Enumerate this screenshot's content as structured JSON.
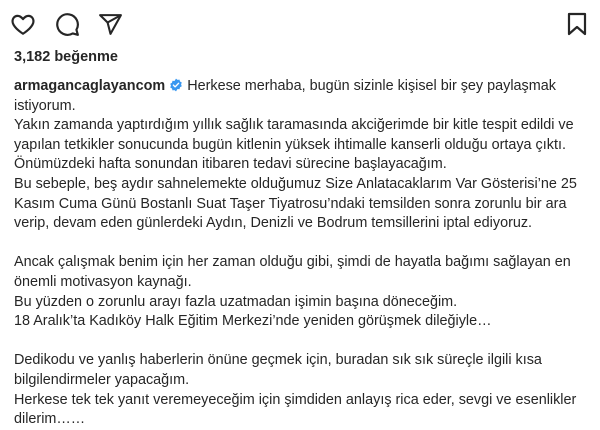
{
  "post": {
    "likes_text": "3,182 beğenme",
    "username": "armagancaglayancom",
    "verified": true,
    "caption_first_line": "Herkese merhaba, bugün sizinle kişisel bir şey paylaşmak",
    "caption_lines": [
      "istiyorum.",
      "Yakın zamanda yaptırdığım yıllık sağlık taramasında akciğerimde bir kitle tespit edildi ve",
      "yapılan tetkikler sonucunda bugün kitlenin yüksek ihtimalle kanserli olduğu ortaya çıktı.",
      "Önümüzdeki hafta sonundan itibaren tedavi sürecine başlayacağım.",
      "Bu sebeple, beş aydır sahnelemekte olduğumuz Size Anlatacaklarım Var Gösterisi’ne 25",
      "Kasım Cuma Günü Bostanlı Suat Taşer Tiyatrosu’ndaki temsilden sonra zorunlu bir ara",
      "verip, devam eden günlerdeki Aydın, Denizli ve Bodrum temsillerini iptal ediyoruz.",
      "",
      "Ancak çalışmak benim için her zaman olduğu gibi, şimdi de hayatla bağımı sağlayan en",
      "önemli motivasyon kaynağı.",
      "Bu yüzden o zorunlu arayı fazla uzatmadan işimin başına döneceğim.",
      "18 Aralık’ta Kadıköy Halk Eğitim Merkezi’nde yeniden görüşmek dileğiyle…",
      "",
      "Dedikodu ve yanlış haberlerin önüne geçmek için, buradan sık sık süreçle ilgili kısa",
      "bilgilendirmeler yapacağım.",
      "Herkese tek tek yanıt veremeyeceğim için şimdiden anlayış rica eder, sevgi ve esenlikler",
      "dilerim……"
    ]
  },
  "actions": {
    "like_icon": "heart-icon",
    "comment_icon": "comment-icon",
    "share_icon": "share-icon",
    "save_icon": "bookmark-icon"
  },
  "colors": {
    "text": "#262626",
    "verified_badge": "#3897f0"
  }
}
